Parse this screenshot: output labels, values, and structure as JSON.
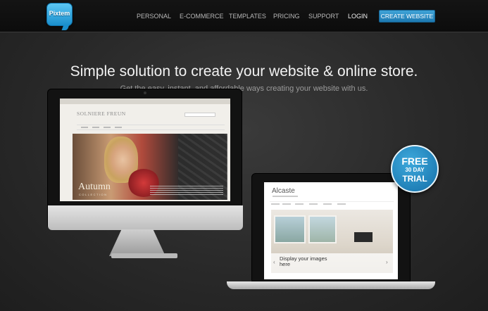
{
  "brand": {
    "logo_text": "Pixtem",
    "accent_color": "#1d78b0"
  },
  "nav": {
    "items": [
      {
        "label": "PERSONAL"
      },
      {
        "label": "E-COMMERCE"
      },
      {
        "label": "TEMPLATES"
      },
      {
        "label": "PRICING"
      },
      {
        "label": "SUPPORT"
      },
      {
        "label": "LOGIN"
      }
    ],
    "cta_label": "CREATE WEBSITE"
  },
  "hero": {
    "headline": "Simple solution to create your website & online store.",
    "subheadline": "Get the easy, instant, and affordable ways creating your website with us."
  },
  "desktop_preview": {
    "site_title": "SOLNIERE FREUN",
    "banner_title": "Autumn",
    "banner_subtitle": "COLLECTION"
  },
  "laptop_preview": {
    "site_title": "Alcaste",
    "banner_caption": "Display your images here",
    "prev_arrow": "‹",
    "next_arrow": "›"
  },
  "badge": {
    "line1": "FREE",
    "line2": "30 DAY",
    "line3": "TRIAL"
  }
}
